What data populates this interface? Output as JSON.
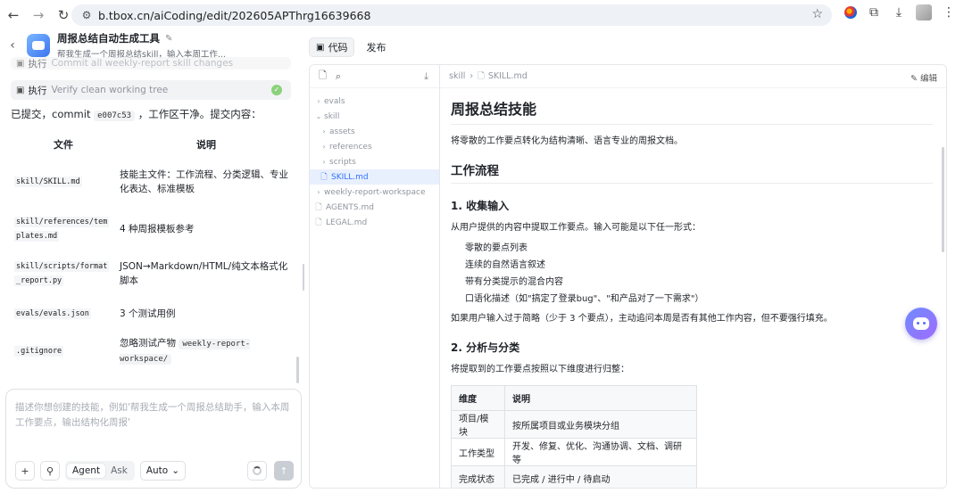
{
  "browser": {
    "url_host": "b.tbox.cn",
    "url_path": "/aiCoding/edit/202605APThrg16639668",
    "icons": [
      "back-icon",
      "forward-icon",
      "reload-icon",
      "site-settings-icon",
      "bookmark-star-icon",
      "extensions-icon",
      "download-icon",
      "menu-icon"
    ]
  },
  "app": {
    "title": "周报总结自动生成工具",
    "subtitle": "帮我生成一个周报总结skill，输入本周工作..."
  },
  "chat": {
    "prev_step": {
      "keyword": "执行",
      "desc": "Commit all weekly-report skill changes"
    },
    "step": {
      "keyword": "执行",
      "desc": "Verify clean working tree"
    },
    "commit_prefix": "已提交，commit",
    "commit_hash": "e007c53",
    "commit_suffix": "，工作区干净。提交内容：",
    "table_headers": [
      "文件",
      "说明"
    ],
    "files": [
      {
        "file": "skill/SKILL.md",
        "desc": "技能主文件：工作流程、分类逻辑、专业化表达、标准模板"
      },
      {
        "file": "skill/references/templates.md",
        "desc": "4 种周报模板参考"
      },
      {
        "file": "skill/scripts/format_report.py",
        "desc": "JSON→Markdown/HTML/纯文本格式化脚本"
      },
      {
        "file": "evals/evals.json",
        "desc": "3 个测试用例"
      },
      {
        "file": ".gitignore",
        "desc_prefix": "忽略测试产物",
        "desc_code": "weekly-report-workspace/"
      }
    ],
    "file_lines": [
      [
        "skill/SKILL.md"
      ],
      [
        "skill/references/tem",
        "plates.md"
      ],
      [
        "skill/scripts/format",
        "_report.py"
      ],
      [
        "evals/evals.json"
      ],
      [
        ".gitignore"
      ]
    ],
    "composer_placeholder": "描述你想创建的技能，例如'帮我生成一个周报总结助手，输入本周工作要点，输出结构化周报'",
    "mode_agent": "Agent",
    "mode_ask": "Ask",
    "model": "Auto",
    "add_label": "+"
  },
  "workspace": {
    "tabs": [
      {
        "label": "代码",
        "active": true
      },
      {
        "label": "发布",
        "active": false
      }
    ],
    "tree": [
      {
        "label": "evals",
        "type": "folder",
        "open": false,
        "depth": 0
      },
      {
        "label": "skill",
        "type": "folder",
        "open": true,
        "depth": 0
      },
      {
        "label": "assets",
        "type": "folder",
        "open": false,
        "depth": 1
      },
      {
        "label": "references",
        "type": "folder",
        "open": false,
        "depth": 1
      },
      {
        "label": "scripts",
        "type": "folder",
        "open": false,
        "depth": 1
      },
      {
        "label": "SKILL.md",
        "type": "file",
        "selected": true,
        "depth": 1
      },
      {
        "label": "weekly-report-workspace",
        "type": "folder",
        "open": false,
        "depth": 0
      },
      {
        "label": "AGENTS.md",
        "type": "file",
        "depth": 0
      },
      {
        "label": "LEGAL.md",
        "type": "file",
        "depth": 0
      }
    ],
    "breadcrumb_folder": "skill",
    "breadcrumb_file": "SKILL.md",
    "edit_label": "编辑"
  },
  "doc": {
    "h1": "周报总结技能",
    "intro": "将零散的工作要点转化为结构清晰、语言专业的周报文档。",
    "h2_workflow": "工作流程",
    "h3_collect": "1. 收集输入",
    "collect_text": "从用户提供的内容中提取工作要点。输入可能是以下任一形式：",
    "collect_items": [
      "零散的要点列表",
      "连续的自然语言叙述",
      "带有分类提示的混合内容",
      "口语化描述（如\"搞定了登录bug\"、\"和产品对了一下需求\"）"
    ],
    "collect_note": "如果用户输入过于简略（少于 3 个要点），主动追问本周是否有其他工作内容，但不要强行填充。",
    "h3_analyze": "2. 分析与分类",
    "analyze_text": "将提取到的工作要点按照以下维度进行归整：",
    "dim_headers": [
      "维度",
      "说明"
    ],
    "dims": [
      [
        "项目/模块",
        "按所属项目或业务模块分组"
      ],
      [
        "工作类型",
        "开发、修复、优化、沟通协调、文档、调研等"
      ],
      [
        "完成状态",
        "已完成 / 进行中 / 待启动"
      ]
    ]
  }
}
